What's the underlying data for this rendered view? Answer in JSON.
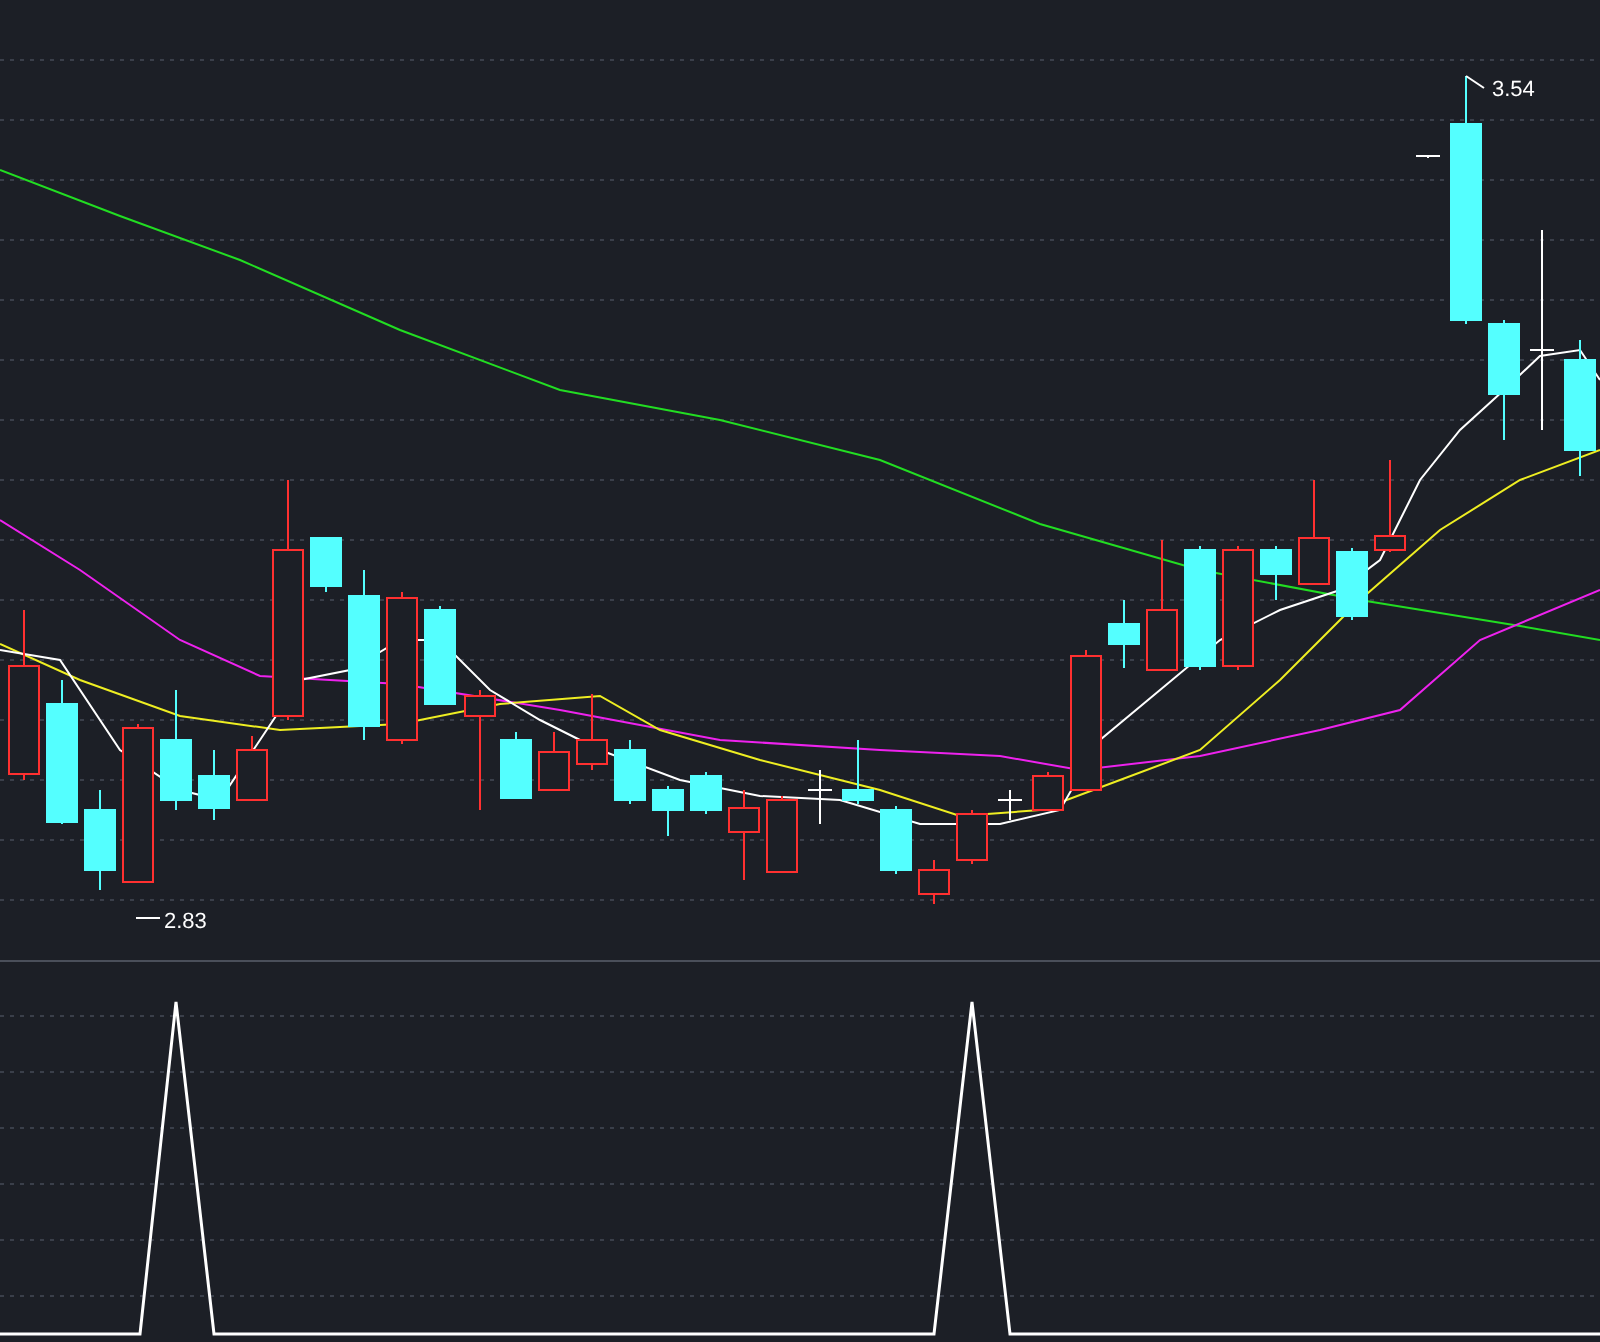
{
  "price_chart": {
    "high_label": "3.54",
    "low_label": "2.83"
  }
}
